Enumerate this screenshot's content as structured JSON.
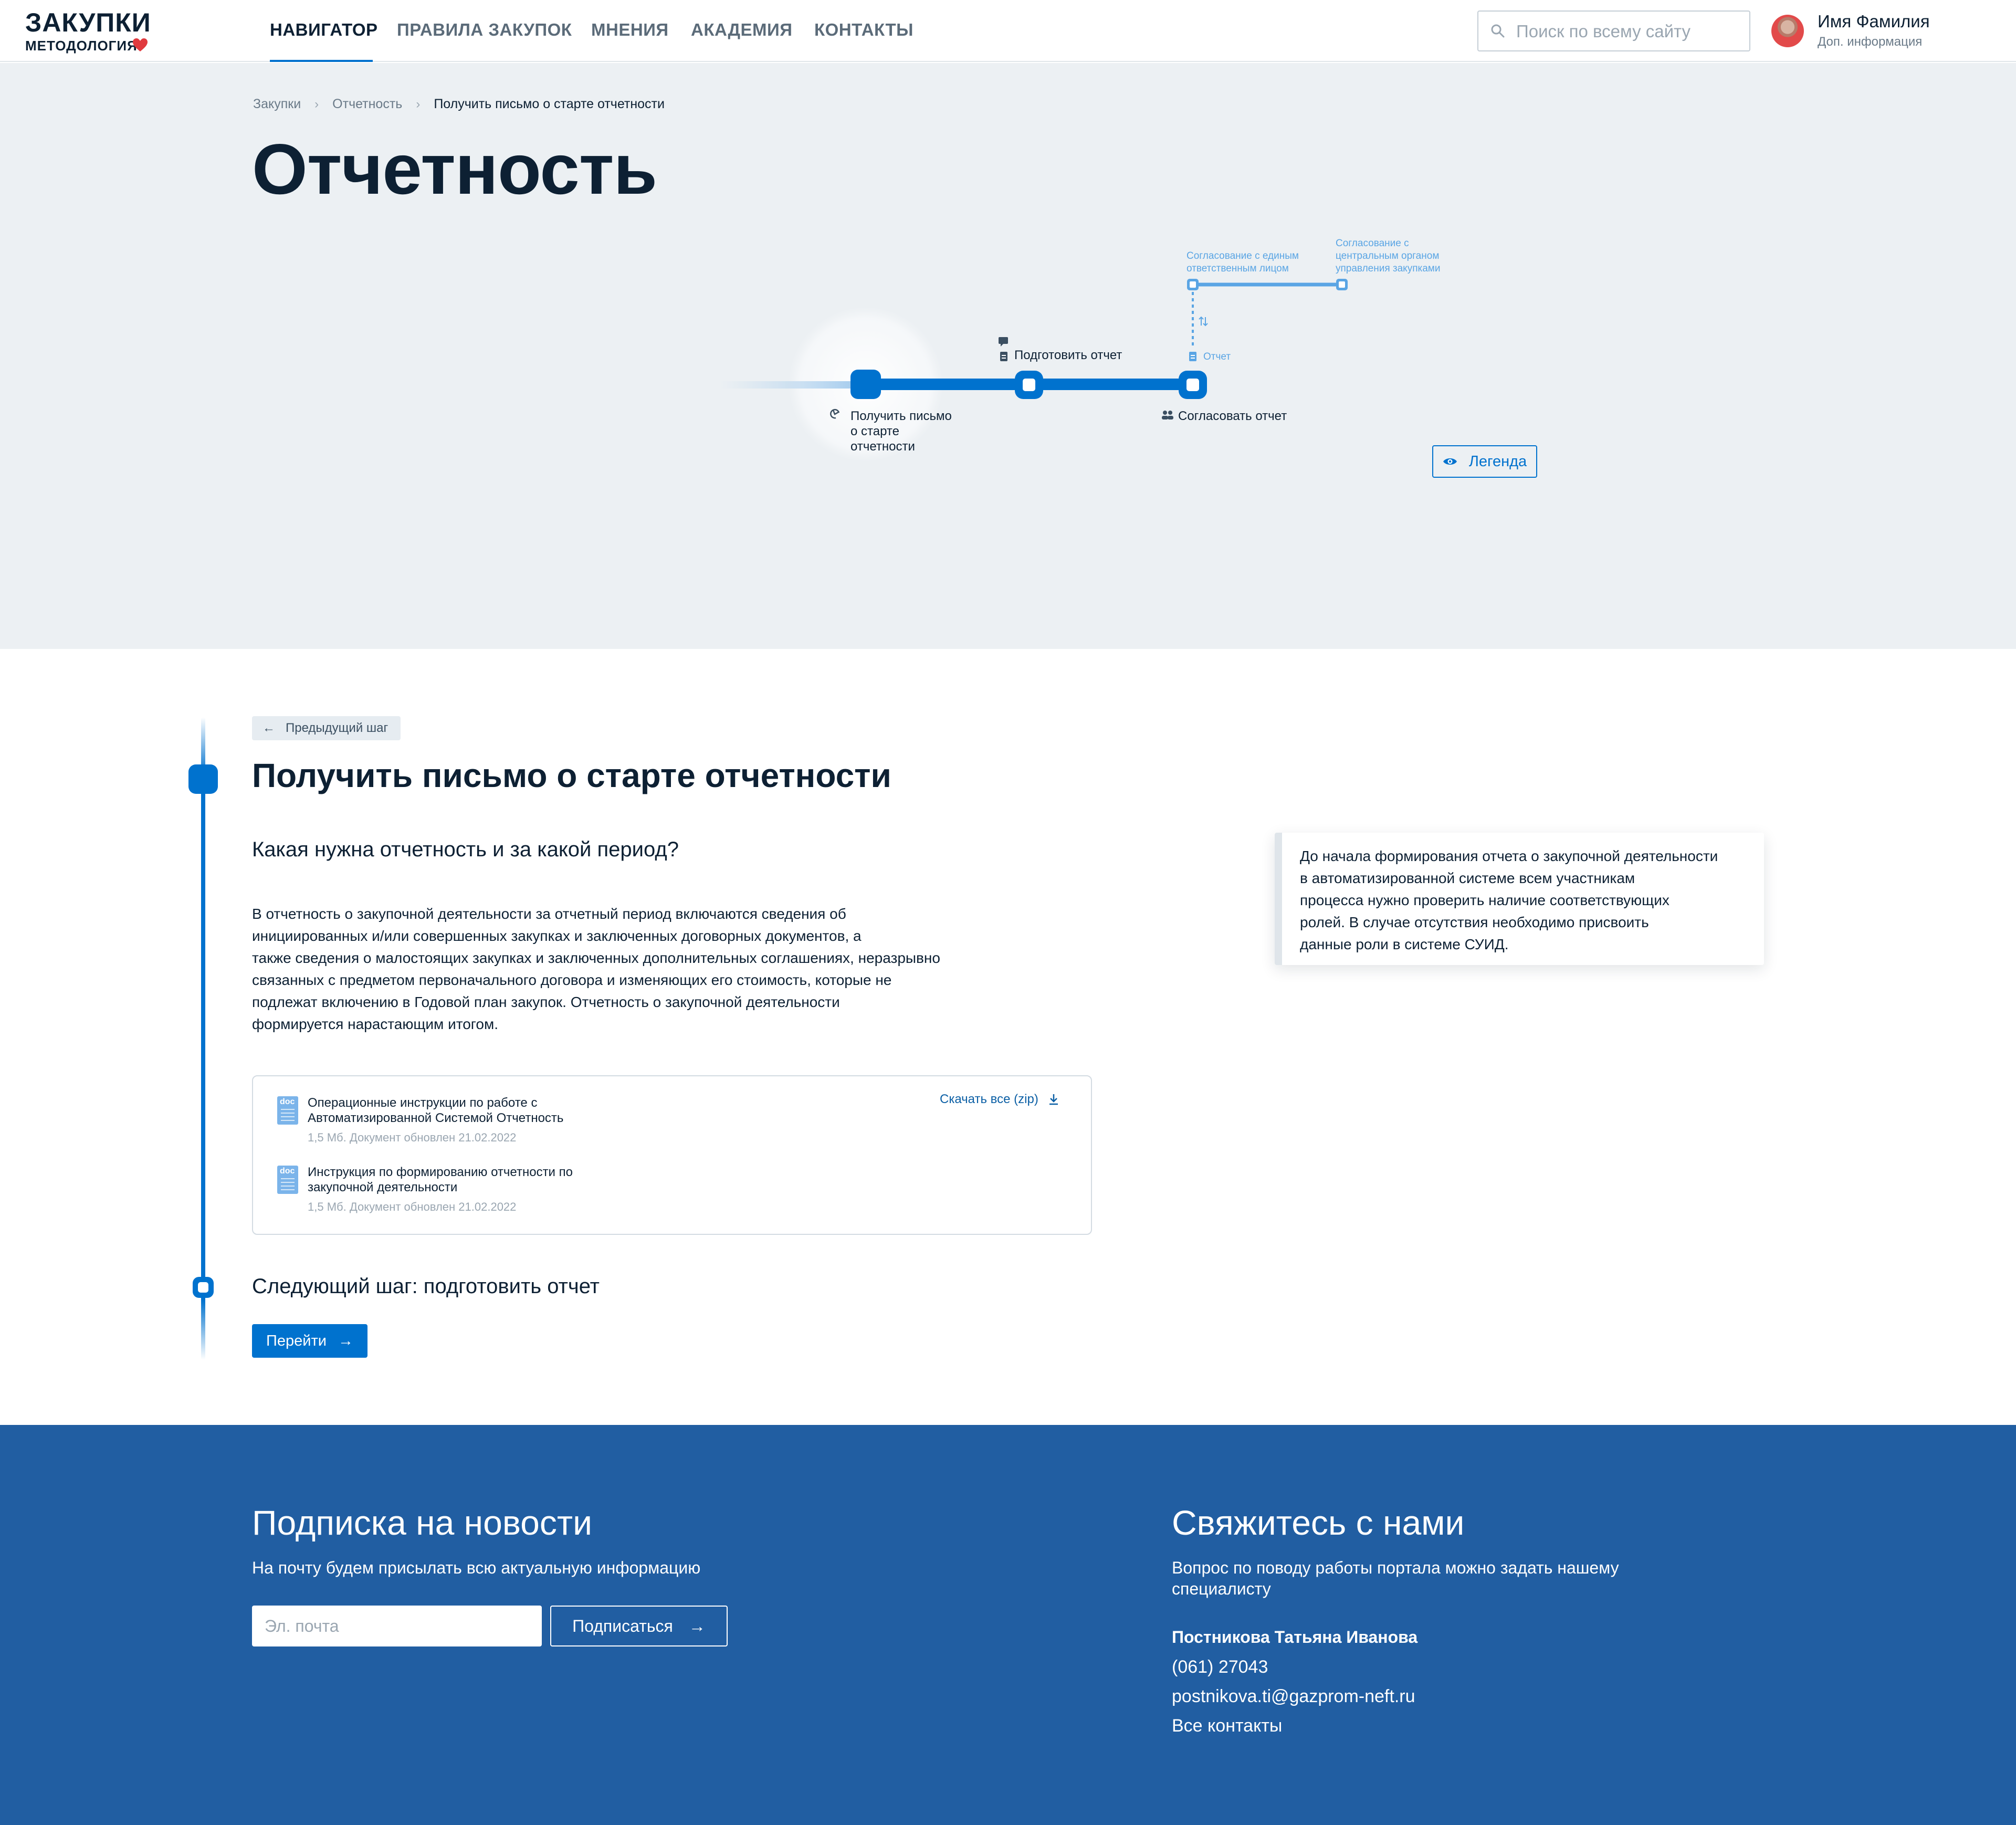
{
  "header": {
    "logo_title": "ЗАКУПКИ",
    "logo_subtitle": "МЕТОДОЛОГИЯ",
    "nav": [
      {
        "label": "НАВИГАТОР",
        "active": true
      },
      {
        "label": "ПРАВИЛА ЗАКУПОК",
        "active": false
      },
      {
        "label": "МНЕНИЯ",
        "active": false
      },
      {
        "label": "АКАДЕМИЯ",
        "active": false
      },
      {
        "label": "КОНТАКТЫ",
        "active": false
      }
    ],
    "search_placeholder": "Поиск по всему сайту",
    "user_name": "Имя Фамилия",
    "user_info": "Доп. информация"
  },
  "breadcrumb": [
    "Закупки",
    "Отчетность",
    "Получить письмо о старте отчетности"
  ],
  "page_title": "Отчетность",
  "flow": {
    "step1_label": [
      "Получить письмо",
      "о старте",
      "отчетности"
    ],
    "step2_label": "Подготовить отчет",
    "step3_label": "Согласовать отчет",
    "branch1_label": [
      "Согласование с единым",
      "ответственным лицом"
    ],
    "branch2_label": [
      "Согласование с",
      "центральным органом",
      "управления закупками"
    ],
    "report_label": "Отчет",
    "legend_button": "Легенда",
    "accent_color": "#0072ce",
    "light_color": "#5aa5e4"
  },
  "step": {
    "prev_step": "Предыдущий шаг",
    "title": "Получить письмо о старте отчетности",
    "question": "Какая нужна отчетность и за какой период?",
    "text_lines": [
      "В отчетность о закупочной деятельности за отчетный период включаются сведения об",
      "инициированных и/или совершенных закупках и заключенных договорных документов, а",
      "также сведения о малостоящих закупках и заключенных дополнительных соглашениях, неразрывно",
      "связанных с предметом первоначального договора и изменяющих его стоимость, которые не",
      "подлежат включению в Годовой   план закупок. Отчетность о закупочной деятельности",
      "формируется нарастающим итогом."
    ],
    "documents": [
      {
        "icon": "doc",
        "title_lines": [
          "Операционные инструкции по работе с",
          "Автоматизированной Системой Отчетность"
        ],
        "meta": "1,5 Мб. Документ обновлен 21.02.2022"
      },
      {
        "icon": "doc",
        "title_lines": [
          "Инструкция по формированию отчетности по",
          "закупочной деятельности"
        ],
        "meta": "1,5 Мб. Документ обновлен 21.02.2022"
      }
    ],
    "download_all": "Скачать все (zip)",
    "next_title": "Следующий шаг: подготовить отчет",
    "go_button": "Перейти",
    "note_lines": [
      "До начала формирования отчета о закупочной деятельности",
      "в автоматизированной системе всем   участникам",
      "процесса   нужно   проверить   наличие соответствующих",
      "ролей. В  случае   отсутствия   необходимо присвоить",
      "данные роли в системе СУИД."
    ]
  },
  "footer": {
    "subscribe_title": "Подписка на новости",
    "subscribe_text": "На почту будем присылать всю актуальную информацию",
    "email_placeholder": "Эл. почта",
    "subscribe_button": "Подписаться",
    "contact_title": "Свяжитесь с нами",
    "contact_text": [
      "Вопрос по поводу работы портала можно задать нашему",
      "специалисту"
    ],
    "contact_name": "Постникова Татьяна Иванова",
    "contact_phone": "(061) 27043",
    "contact_email": "postnikova.ti@gazprom-neft.ru",
    "all_contacts": "Все контакты",
    "background": "#215ea2"
  }
}
